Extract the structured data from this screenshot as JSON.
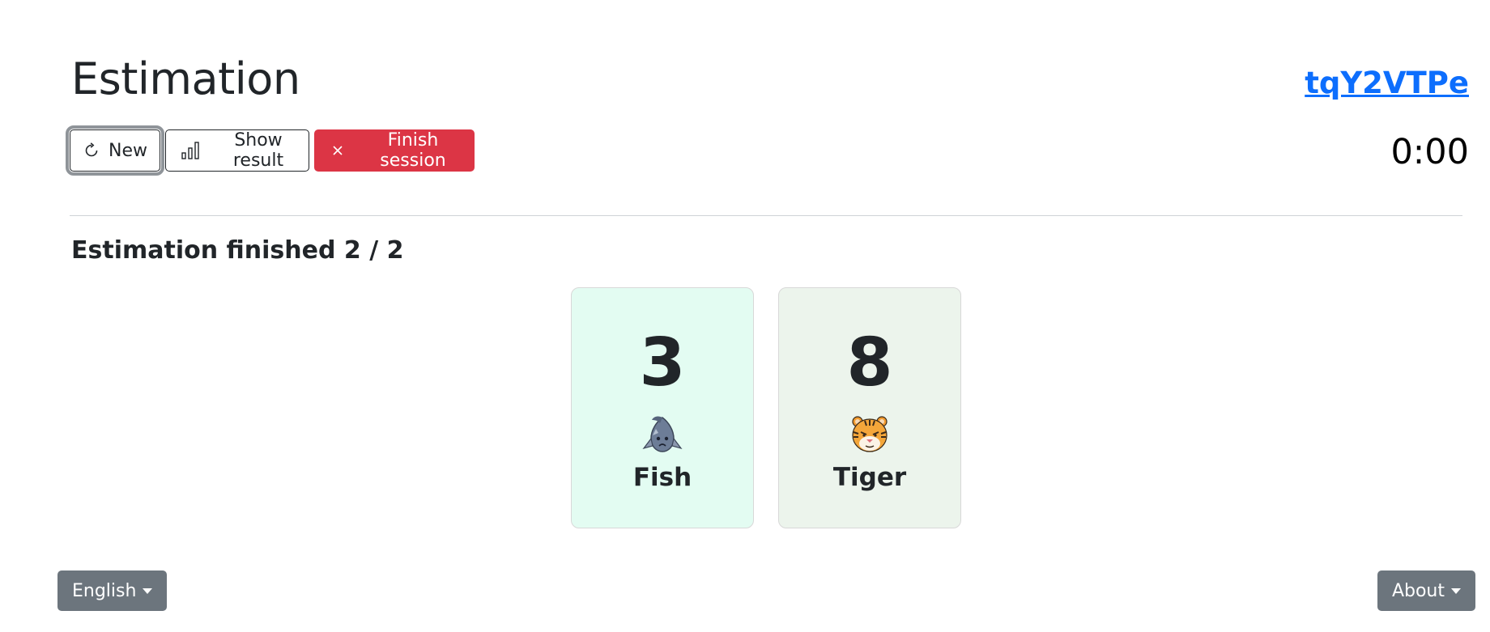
{
  "header": {
    "title": "Estimation",
    "session_id": "tqY2VTPe",
    "timer": "0:00"
  },
  "toolbar": {
    "new_label": "New",
    "show_result_label": "Show result",
    "finish_label": "Finish session"
  },
  "status": {
    "text": "Estimation finished 2 / 2"
  },
  "cards": [
    {
      "value": "3",
      "name": "Fish",
      "avatar": "fish-icon",
      "color": "#e3fcf2"
    },
    {
      "value": "8",
      "name": "Tiger",
      "avatar": "tiger-icon",
      "color": "#ecf4ec"
    }
  ],
  "footer": {
    "language_label": "English",
    "about_label": "About"
  },
  "colors": {
    "link": "#0d6efd",
    "danger": "#dc3545",
    "secondary": "#6c757d"
  }
}
